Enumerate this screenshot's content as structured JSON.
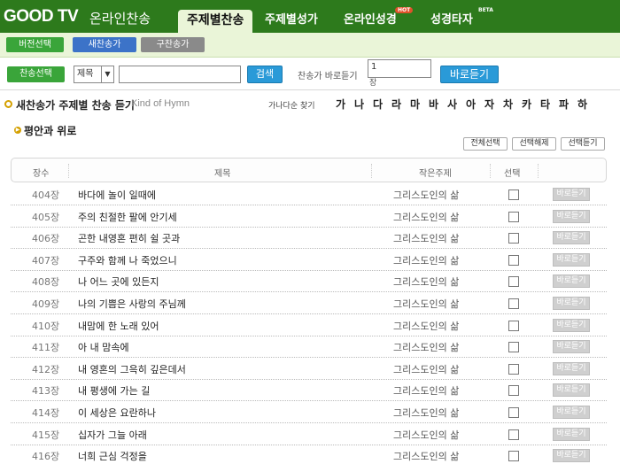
{
  "header": {
    "logo": "GOOD TV",
    "logo_sub": "온라인찬송",
    "tabs": [
      {
        "label": "주제별찬송"
      },
      {
        "label": "주제별성가"
      },
      {
        "label": "온라인성경",
        "badge": "HOT"
      },
      {
        "label": "성경타자",
        "badge": "BETA"
      }
    ]
  },
  "hymnal_buttons": [
    {
      "label": "버전선택",
      "color": "#3aa53a"
    },
    {
      "label": "새찬송가",
      "color": "#3c73c8"
    },
    {
      "label": "구찬송가",
      "color": "#8a8a8a"
    }
  ],
  "search": {
    "select_button": "찬송선택",
    "field_select": "제목",
    "query_value": "",
    "search_button": "검색",
    "number_label": "찬송가 바로듣기",
    "number_value": "1",
    "number_suffix": "장",
    "listen_button": "바로듣기"
  },
  "page": {
    "title": "새찬송가 주제별 찬송 듣기",
    "title_en": "Kind of Hymn",
    "consonant_label": "가나다순 찾기",
    "consonants": [
      "가",
      "나",
      "다",
      "라",
      "마",
      "바",
      "사",
      "아",
      "자",
      "차",
      "카",
      "타",
      "파",
      "하"
    ]
  },
  "section": {
    "title": "평안과 위로",
    "buttons": [
      "전체선택",
      "선택해제",
      "선택듣기"
    ]
  },
  "table": {
    "headers": [
      "장수",
      "제목",
      "작은주제",
      "선택"
    ],
    "play_label": "바로듣기",
    "rows": [
      {
        "no": "404장",
        "title": "바다에 놀이 일때에",
        "theme": "그리스도인의 삶"
      },
      {
        "no": "405장",
        "title": "주의 친절한 팔에 안기세",
        "theme": "그리스도인의 삶"
      },
      {
        "no": "406장",
        "title": "곤한 내영혼 편히 쉴 곳과",
        "theme": "그리스도인의 삶"
      },
      {
        "no": "407장",
        "title": "구주와 함께 나 죽었으니",
        "theme": "그리스도인의 삶"
      },
      {
        "no": "408장",
        "title": "나 어느 곳에 있든지",
        "theme": "그리스도인의 삶"
      },
      {
        "no": "409장",
        "title": "나의 기쁨은 사랑의 주님께",
        "theme": "그리스도인의 삶"
      },
      {
        "no": "410장",
        "title": "내맘에 한 노래 있어",
        "theme": "그리스도인의 삶"
      },
      {
        "no": "411장",
        "title": "아 내 맘속에",
        "theme": "그리스도인의 삶"
      },
      {
        "no": "412장",
        "title": "내 영혼의 그윽히 깊은데서",
        "theme": "그리스도인의 삶"
      },
      {
        "no": "413장",
        "title": "내 평생에 가는 길",
        "theme": "그리스도인의 삶"
      },
      {
        "no": "414장",
        "title": "이 세상은 요란하나",
        "theme": "그리스도인의 삶"
      },
      {
        "no": "415장",
        "title": "십자가 그늘 아래",
        "theme": "그리스도인의 삶"
      },
      {
        "no": "416장",
        "title": "너희 근심 걱정을",
        "theme": "그리스도인의 삶"
      }
    ]
  }
}
